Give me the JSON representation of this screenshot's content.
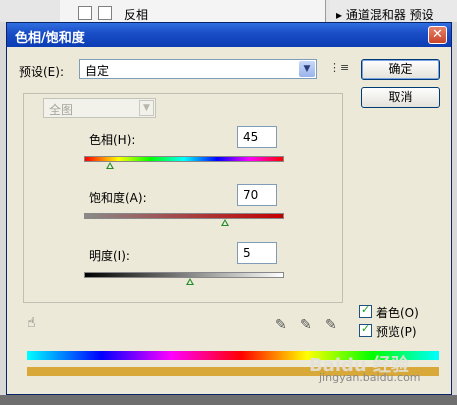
{
  "background": {
    "layer_label": "反相",
    "panel_text": "▸ 通道混和器 预设"
  },
  "dialog": {
    "title": "色相/饱和度",
    "close_glyph": "✕"
  },
  "preset": {
    "label": "预设(E):",
    "value": "自定",
    "menu_glyph": "⋮≡"
  },
  "buttons": {
    "ok": "确定",
    "cancel": "取消"
  },
  "edit": {
    "value": "全图"
  },
  "sliders": {
    "hue": {
      "label": "色相(H):",
      "value": "45",
      "fraction": 0.125
    },
    "saturation": {
      "label": "饱和度(A):",
      "value": "70",
      "fraction": 0.7
    },
    "lightness": {
      "label": "明度(I):",
      "value": "5",
      "fraction": 0.525
    }
  },
  "options": {
    "colorize": {
      "label": "着色(O)",
      "checked": true
    },
    "preview": {
      "label": "预览(P)",
      "checked": true
    }
  },
  "watermark": {
    "logo": "Baidu 经验",
    "url": "jingyan.baidu.com"
  },
  "colors": {
    "title_blue": "#0a3cb4",
    "dialog_bg": "#ece9d8",
    "result_bar": "#d8a838"
  }
}
